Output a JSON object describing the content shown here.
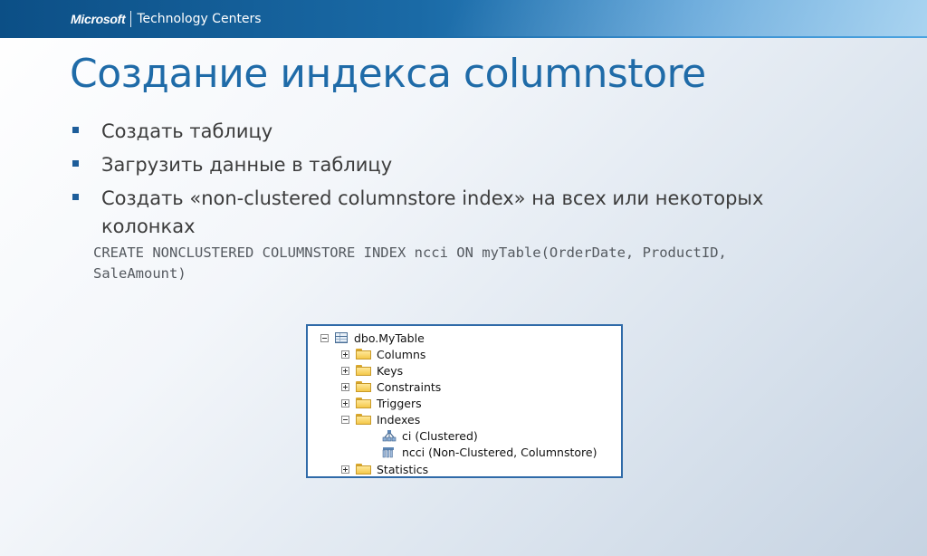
{
  "header": {
    "brand_logo": "Microsoft",
    "brand_subtitle": "Technology Centers"
  },
  "slide": {
    "title": "Создание индекса columnstore",
    "bullets": [
      "Создать таблицу",
      "Загрузить данные в таблицу",
      "Создать «non-clustered columnstore index» на всех или некоторых колонках"
    ],
    "code": "CREATE NONCLUSTERED COLUMNSTORE INDEX ncci ON myTable(OrderDate, ProductID, SaleAmount)"
  },
  "tree": {
    "root": {
      "label": "dbo.MyTable",
      "icon": "table-icon",
      "expanded": true
    },
    "children": [
      {
        "label": "Columns",
        "icon": "folder-icon",
        "expanded": false
      },
      {
        "label": "Keys",
        "icon": "folder-icon",
        "expanded": false
      },
      {
        "label": "Constraints",
        "icon": "folder-icon",
        "expanded": false
      },
      {
        "label": "Triggers",
        "icon": "folder-icon",
        "expanded": false
      },
      {
        "label": "Indexes",
        "icon": "folder-icon",
        "expanded": true
      },
      {
        "label": "Statistics",
        "icon": "folder-icon",
        "expanded": false
      }
    ],
    "indexes": [
      {
        "label": "ci (Clustered)",
        "icon": "clustered-index-icon"
      },
      {
        "label": "ncci (Non-Clustered, Columnstore)",
        "icon": "columnstore-index-icon"
      }
    ]
  },
  "colors": {
    "title": "#1f6ba8",
    "header_bar": "#1a6aa6",
    "bullet_mark": "#1d5d9a",
    "tree_border": "#2f6aa8"
  }
}
